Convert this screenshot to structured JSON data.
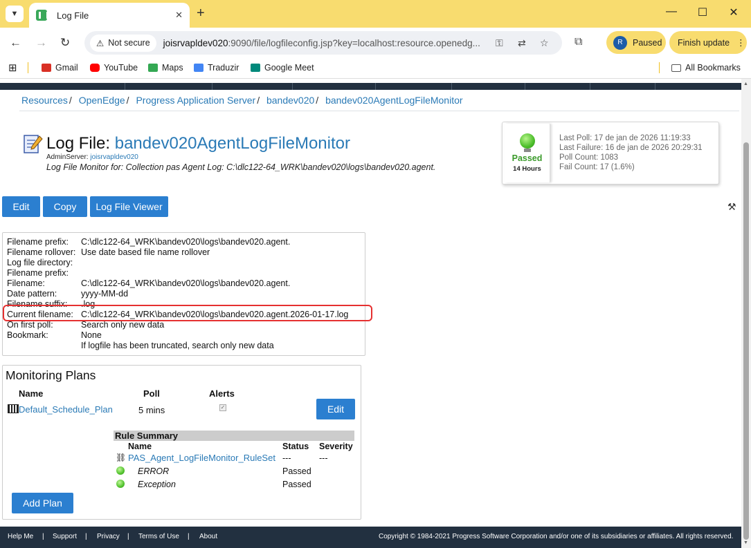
{
  "browser": {
    "tab_title": "Log File",
    "new_tab": "+",
    "not_secure": "Not secure",
    "url_host": "joisrvapldev020",
    "url_rest": ":9090/file/logfileconfig.jsp?key=localhost:resource.openedg...",
    "profile_initial": "R",
    "profile_status": "Paused",
    "finish_update": "Finish update",
    "bookmarks": [
      "Gmail",
      "YouTube",
      "Maps",
      "Traduzir",
      "Google Meet"
    ],
    "all_bookmarks": "All Bookmarks"
  },
  "breadcrumb": [
    "Resources",
    "OpenEdge",
    "Progress Application Server",
    "bandev020",
    "bandev020AgentLogFileMonitor"
  ],
  "header": {
    "title_prefix": "Log File:",
    "title_name": "bandev020AgentLogFileMonitor",
    "admin_label": "AdminServer:",
    "admin_server": "joisrvapldev020",
    "description": "Log File Monitor for: Collection pas Agent Log: C:\\dlc122-64_WRK\\bandev020\\logs\\bandev020.agent."
  },
  "status": {
    "state": "Passed",
    "duration": "14 Hours",
    "last_poll": "Last Poll: 17 de jan de 2026 11:19:33",
    "last_failure": "Last Failure: 16 de jan de 2026 20:29:31",
    "poll_count": "Poll Count: 1083",
    "fail_count": "Fail Count: 17 (1.6%)",
    "color_passed": "#3a9a2a"
  },
  "actions": {
    "edit": "Edit",
    "copy": "Copy",
    "viewer": "Log File Viewer"
  },
  "properties": [
    {
      "label": "Filename prefix:",
      "value": "C:\\dlc122-64_WRK\\bandev020\\logs\\bandev020.agent."
    },
    {
      "label": "Filename rollover:",
      "value": "Use date based file name rollover"
    },
    {
      "label": "Log file directory:",
      "value": ""
    },
    {
      "label": "Filename prefix:",
      "value": ""
    },
    {
      "label": "Filename:",
      "value": "C:\\dlc122-64_WRK\\bandev020\\logs\\bandev020.agent."
    },
    {
      "label": "Date pattern:",
      "value": "yyyy-MM-dd"
    },
    {
      "label": "Filename suffix:",
      "value": ".log"
    },
    {
      "label": "Current filename:",
      "value": "C:\\dlc122-64_WRK\\bandev020\\logs\\bandev020.agent.2026-01-17.log"
    },
    {
      "label": "On first poll:",
      "value": "Search only new data"
    },
    {
      "label": "Bookmark:",
      "value": "None"
    },
    {
      "label": "",
      "value": "If logfile has been truncated, search only new data"
    }
  ],
  "plans": {
    "title": "Monitoring Plans",
    "col_name": "Name",
    "col_poll": "Poll",
    "col_alerts": "Alerts",
    "plan_name": "Default_Schedule_Plan",
    "plan_poll": "5 mins",
    "edit": "Edit",
    "rule_summary": "Rule Summary",
    "rule_col_name": "Name",
    "rule_col_status": "Status",
    "rule_col_severity": "Severity",
    "ruleset_name": "PAS_Agent_LogFileMonitor_RuleSet",
    "ruleset_status": "---",
    "ruleset_severity": "---",
    "rules": [
      {
        "name": "ERROR",
        "status": "Passed"
      },
      {
        "name": "Exception",
        "status": "Passed"
      }
    ],
    "add_plan": "Add Plan"
  },
  "footer": {
    "help": "Help Me",
    "support": "Support",
    "privacy": "Privacy",
    "terms": "Terms of Use",
    "about": "About",
    "sep": "|",
    "copyright": "Copyright © 1984-2021 Progress Software Corporation and/or one of its subsidiaries or affiliates. All rights reserved."
  }
}
